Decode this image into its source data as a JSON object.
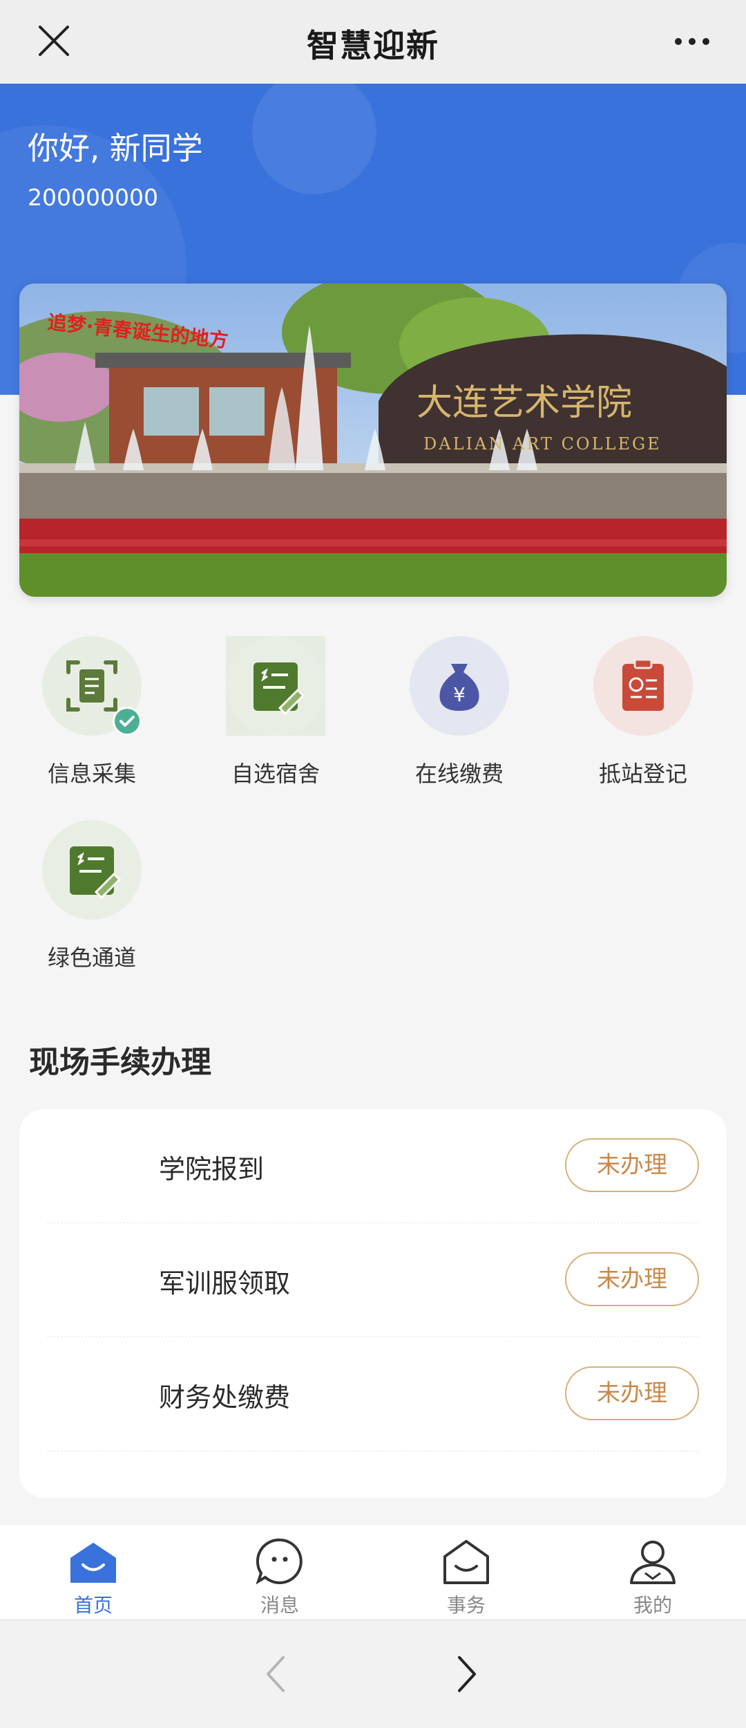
{
  "header": {
    "title": "智慧迎新",
    "close_icon": "close-icon",
    "more_icon": "more-dots-icon"
  },
  "profile": {
    "greeting": "你好, 新同学",
    "student_id": "200000000"
  },
  "banner": {
    "slogan": "追梦·青春诞生的地方",
    "college_name_cn": "大连艺术学院",
    "college_name_en": "DALIAN ART COLLEGE"
  },
  "services": [
    {
      "label": "信息采集",
      "icon": "document-scan-icon",
      "completed": true
    },
    {
      "label": "自选宿舍",
      "icon": "edit-note-icon",
      "completed": false
    },
    {
      "label": "在线缴费",
      "icon": "money-bag-icon",
      "completed": false
    },
    {
      "label": "抵站登记",
      "icon": "clipboard-icon",
      "completed": false
    },
    {
      "label": "绿色通道",
      "icon": "edit-note-icon",
      "completed": false
    }
  ],
  "onsite": {
    "title": "现场手续办理",
    "items": [
      {
        "name": "学院报到",
        "status": "未办理"
      },
      {
        "name": "军训服领取",
        "status": "未办理"
      },
      {
        "name": "财务处缴费",
        "status": "未办理"
      }
    ]
  },
  "tabbar": [
    {
      "label": "首页",
      "icon": "home-icon",
      "active": true
    },
    {
      "label": "消息",
      "icon": "message-icon",
      "active": false
    },
    {
      "label": "事务",
      "icon": "affairs-icon",
      "active": false
    },
    {
      "label": "我的",
      "icon": "user-icon",
      "active": false
    }
  ],
  "browser": {
    "back_icon": "back-arrow-icon",
    "forward_icon": "forward-arrow-icon"
  },
  "colors": {
    "primary": "#3a72dc",
    "status_border": "#d8b079",
    "status_text": "#c8894a",
    "check": "#4caf93"
  }
}
